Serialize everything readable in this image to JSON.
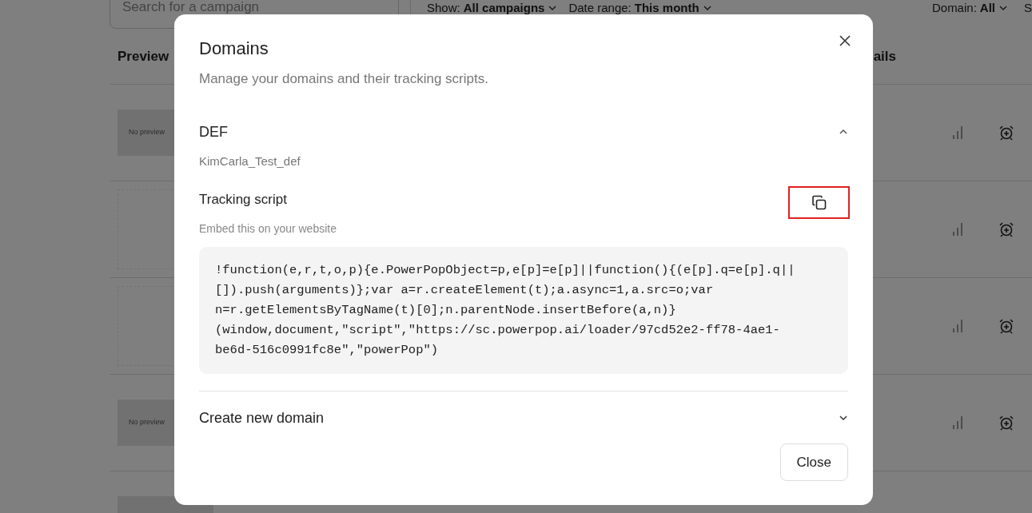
{
  "background": {
    "search": {
      "placeholder": "Search for a campaign"
    },
    "filters": [
      {
        "label": "Show:",
        "value": "All campaigns"
      },
      {
        "label": "Date range:",
        "value": "This month"
      },
      {
        "label": "Domain:",
        "value": "All"
      }
    ],
    "cut_filter": "S",
    "columns": [
      "Preview",
      "ails"
    ],
    "rows": [
      {
        "kind": "placeholder",
        "text": "No preview"
      },
      {
        "kind": "picture"
      },
      {
        "kind": "picture"
      },
      {
        "kind": "placeholder",
        "text": "No preview"
      }
    ],
    "partial_row": {
      "kind": "placeholder"
    }
  },
  "modal": {
    "title": "Domains",
    "subtitle": "Manage your domains and their tracking scripts.",
    "domains": [
      {
        "name": "DEF",
        "expanded": true,
        "domain": "KimCarla_Test_def",
        "script_title": "Tracking script",
        "script_hint": "Embed this on your website",
        "copy_highlighted": true,
        "code_lines": [
          "!function(e,r,t,o,p){e.PowerPopObject=p,e[p]=e[p]||function(){(e[p].q=e[p].q||",
          "[]).push(arguments)};var a=r.createElement(t);a.async=1,a.src=o;var",
          "n=r.getElementsByTagName(t)[0];n.parentNode.insertBefore(a,n)}",
          "(window,document,\"script\",\"https://sc.powerpop.ai/loader/97cd52e2-ff78-4ae1-",
          "be6d-516c0991fc8e\",\"powerPop\")"
        ]
      },
      {
        "name": "Create new domain",
        "expanded": false
      }
    ],
    "close_button": "Close"
  }
}
